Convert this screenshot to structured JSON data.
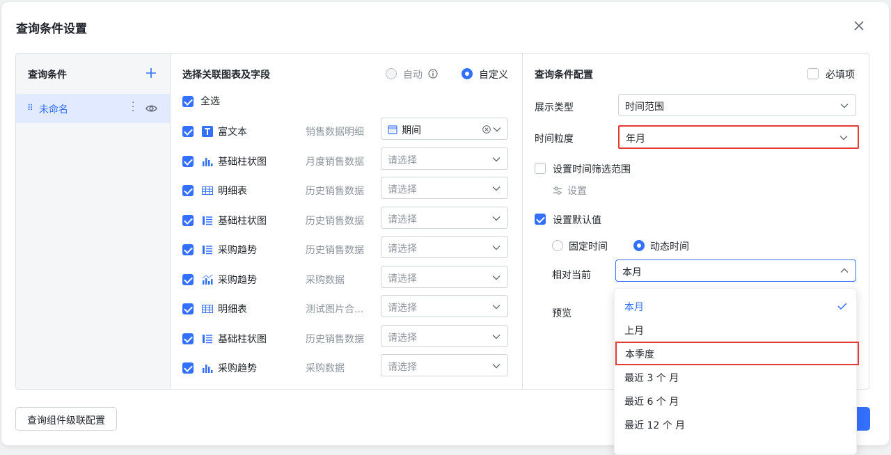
{
  "dialog": {
    "title": "查询条件设置",
    "cascade_button": "查询组件级联配置"
  },
  "left": {
    "header": "查询条件",
    "items": [
      {
        "label": "未命名"
      }
    ]
  },
  "middle": {
    "header": "选择关联图表及字段",
    "mode_auto": "自动",
    "mode_custom": "自定义",
    "select_all": "全选",
    "rows": [
      {
        "chart": "富文本",
        "icon": "text-icon",
        "dataset": "销售数据明细",
        "field": "期间",
        "has_value": true
      },
      {
        "chart": "基础柱状图",
        "icon": "bar-chart-icon",
        "dataset": "月度销售数据",
        "field": "请选择",
        "has_value": false
      },
      {
        "chart": "明细表",
        "icon": "table-icon",
        "dataset": "历史销售数据",
        "field": "请选择",
        "has_value": false
      },
      {
        "chart": "基础柱状图",
        "icon": "list-chart-icon",
        "dataset": "历史销售数据",
        "field": "请选择",
        "has_value": false
      },
      {
        "chart": "采购趋势",
        "icon": "list-chart-icon",
        "dataset": "历史销售数据",
        "field": "请选择",
        "has_value": false
      },
      {
        "chart": "采购趋势",
        "icon": "combo-chart-icon",
        "dataset": "采购数据",
        "field": "请选择",
        "has_value": false
      },
      {
        "chart": "明细表",
        "icon": "table-icon",
        "dataset": "测试图片合...",
        "field": "请选择",
        "has_value": false
      },
      {
        "chart": "基础柱状图",
        "icon": "list-chart-icon",
        "dataset": "历史销售数据",
        "field": "请选择",
        "has_value": false
      },
      {
        "chart": "采购趋势",
        "icon": "bar-chart-icon",
        "dataset": "采购数据",
        "field": "请选择",
        "has_value": false
      }
    ]
  },
  "right": {
    "header": "查询条件配置",
    "required": "必填项",
    "display_type_label": "展示类型",
    "display_type_value": "时间范围",
    "granularity_label": "时间粒度",
    "granularity_value": "年月",
    "filter_range_label": "设置时间筛选范围",
    "settings_link": "设置",
    "default_value_label": "设置默认值",
    "fixed_time": "固定时间",
    "dynamic_time": "动态时间",
    "relative_label": "相对当前",
    "relative_value": "本月",
    "preview_label": "预览",
    "dropdown_options": [
      "本月",
      "上月",
      "本季度",
      "最近 3 个 月",
      "最近 6 个 月",
      "最近 12 个 月"
    ]
  },
  "colors": {
    "accent": "#3370ff",
    "highlight": "#e53935"
  }
}
